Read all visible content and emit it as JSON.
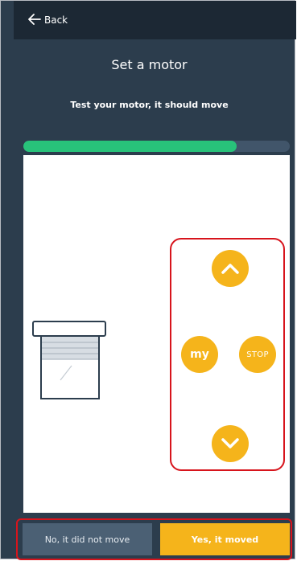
{
  "header": {
    "back_label": "Back"
  },
  "page": {
    "title": "Set a motor",
    "subtitle": "Test your motor, it should move",
    "progress_fraction": 0.8
  },
  "controls": {
    "my_label": "my",
    "stop_label": "STOP"
  },
  "footer": {
    "no_label": "No, it did not move",
    "yes_label": "Yes, it moved"
  },
  "colors": {
    "background": "#2c3d4d",
    "topbar": "#1c2834",
    "accent": "#f5b41b",
    "progress": "#28c27a",
    "highlight": "#d7141c"
  }
}
